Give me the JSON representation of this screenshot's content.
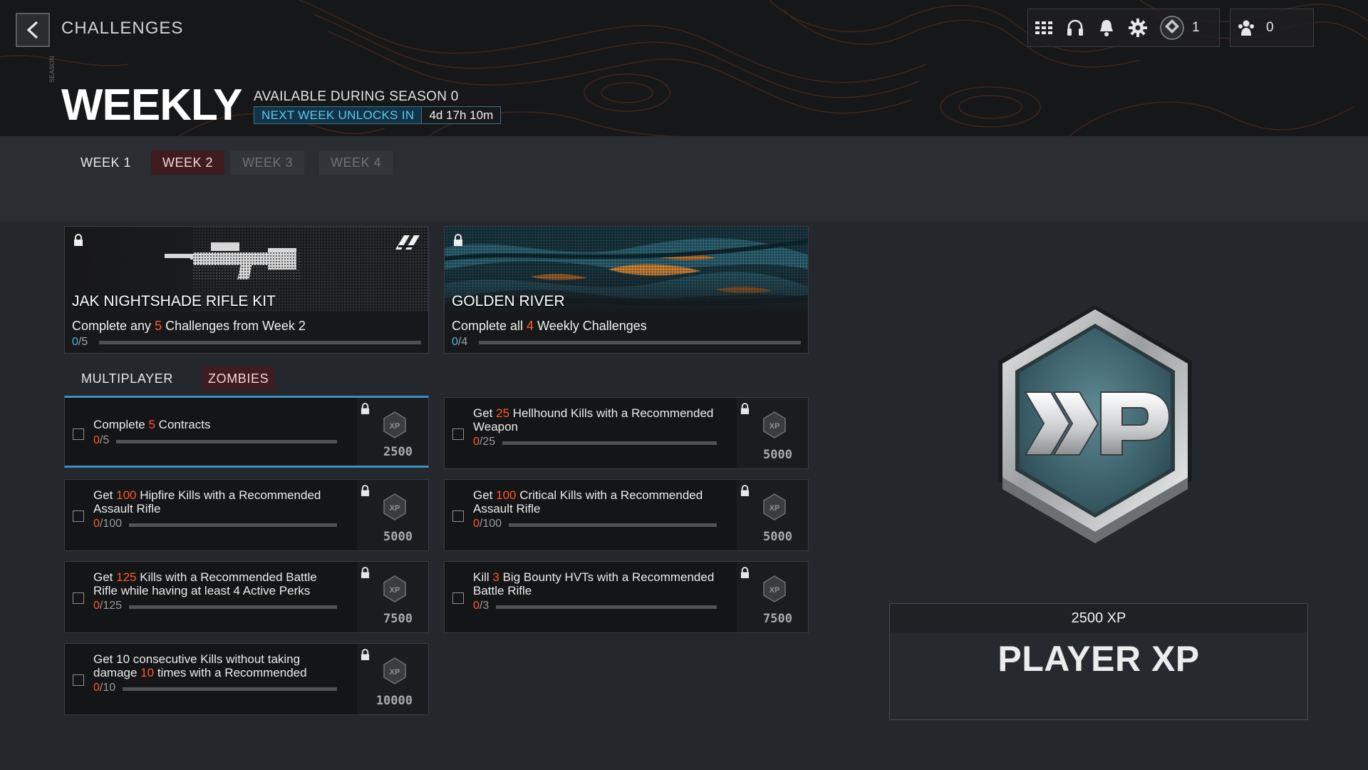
{
  "header": {
    "breadcrumb": "CHALLENGES",
    "title": "WEEKLY",
    "available": "AVAILABLE DURING SEASON 0",
    "unlock_label": "NEXT WEEK UNLOCKS IN",
    "unlock_time": "4d 17h 10m",
    "side_tag": "SEASON"
  },
  "top_right": {
    "icons": [
      "apps-grid-icon",
      "headset-icon",
      "bell-icon",
      "gear-icon",
      "rank-emblem-icon",
      "party-icon"
    ],
    "rank_count": "1",
    "party_count": "0"
  },
  "week_tabs": [
    {
      "label": "WEEK 1",
      "state": "normal"
    },
    {
      "label": "WEEK 2",
      "state": "active"
    },
    {
      "label": "WEEK 3",
      "state": "locked"
    },
    {
      "label": "WEEK 4",
      "state": "locked"
    }
  ],
  "rewards": [
    {
      "name": "JAK NIGHTSHADE RIFLE KIT",
      "desc_pre": "Complete any ",
      "desc_hl": "5",
      "desc_post": " Challenges from Week 2",
      "progress_current": "0",
      "progress_total": "/5",
      "progress_fraction": 0
    },
    {
      "name": "GOLDEN RIVER",
      "desc_pre": "Complete all ",
      "desc_hl": "4",
      "desc_post": " Weekly Challenges",
      "progress_current": "0",
      "progress_total": "/4",
      "progress_fraction": 0
    }
  ],
  "mode_tabs": [
    {
      "label": "MULTIPLAYER",
      "active": false
    },
    {
      "label": "ZOMBIES",
      "active": true
    }
  ],
  "challenges": [
    {
      "pre": "Complete ",
      "hl": "5",
      "post": " Contracts",
      "current": "0",
      "total": "/5",
      "xp": "2500"
    },
    {
      "pre": "Get ",
      "hl": "25",
      "post": " Hellhound Kills with a Recommended Weapon",
      "current": "0",
      "total": "/25",
      "xp": "5000"
    },
    {
      "pre": "Get ",
      "hl": "100",
      "post": " Hipfire Kills with a Recommended Assault Rifle",
      "current": "0",
      "total": "/100",
      "xp": "5000"
    },
    {
      "pre": "Get ",
      "hl": "100",
      "post": " Critical Kills with a Recommended Assault Rifle",
      "current": "0",
      "total": "/100",
      "xp": "5000"
    },
    {
      "pre": "Get ",
      "hl": "125",
      "post": " Kills with a Recommended Battle Rifle while having at least 4 Active Perks",
      "current": "0",
      "total": "/125",
      "xp": "7500"
    },
    {
      "pre": "Kill ",
      "hl": "3",
      "post": " Big Bounty HVTs with a Recommended Battle Rifle",
      "current": "0",
      "total": "/3",
      "xp": "7500"
    },
    {
      "pre": "Get 10 consecutive Kills without taking damage ",
      "hl": "10",
      "post": " times with a Recommended",
      "current": "0",
      "total": "/10",
      "xp": "10000"
    }
  ],
  "reward_panel": {
    "badge_text": "XP",
    "amount": "2500 XP",
    "name": "PLAYER XP"
  },
  "colors": {
    "highlight": "#ff5a2b",
    "accent_blue": "#4db4ea",
    "active_tab": "#3e1c1f",
    "selected_border": "#3e8fc2"
  }
}
